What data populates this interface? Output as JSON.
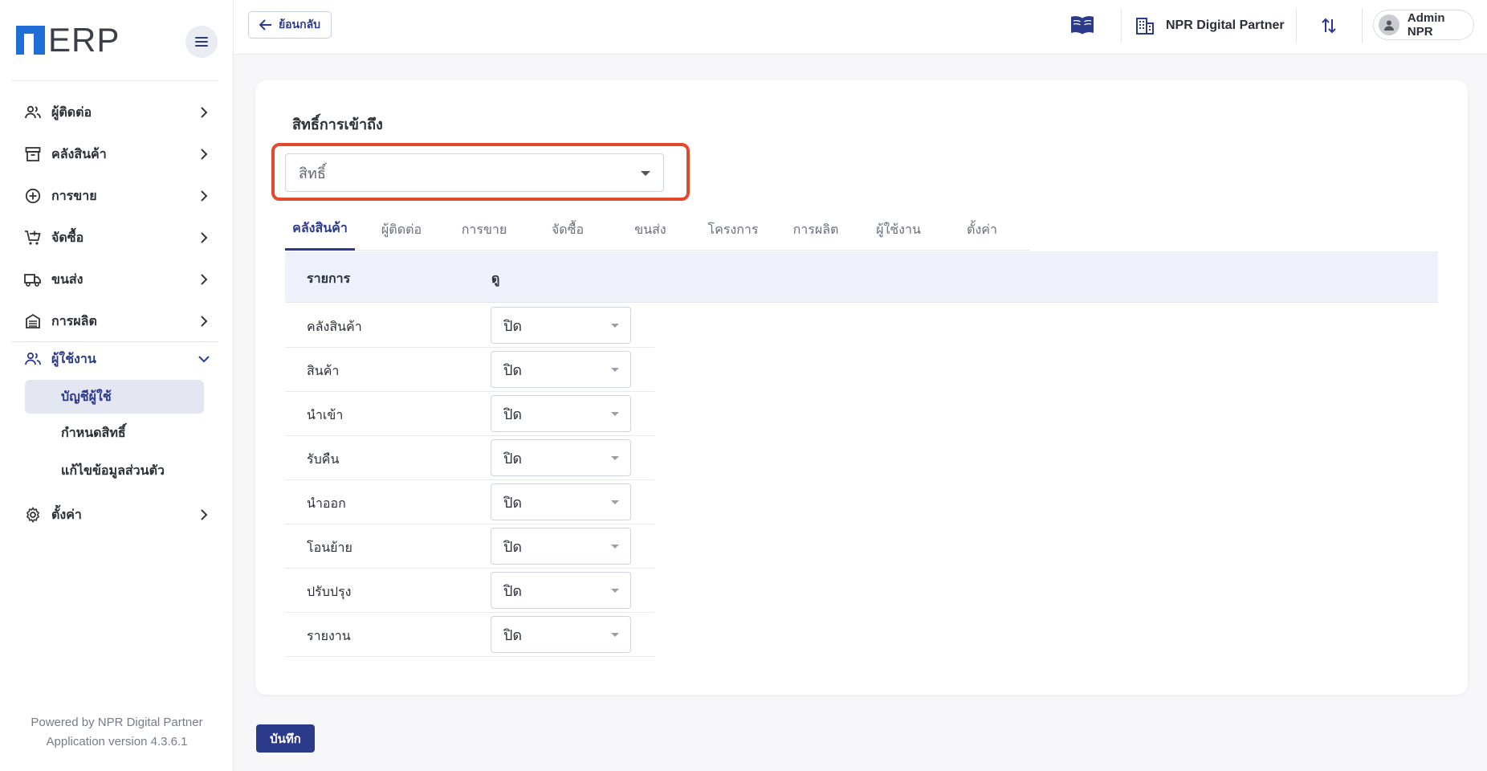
{
  "app": {
    "logo_text": "ERP"
  },
  "sidebar": {
    "items": [
      {
        "label": "ผู้ติดต่อ",
        "icon": "contacts-icon"
      },
      {
        "label": "คลังสินค้า",
        "icon": "archive-box-icon"
      },
      {
        "label": "การขาย",
        "icon": "plus-circle-icon"
      },
      {
        "label": "จัดซื้อ",
        "icon": "cart-plus-icon"
      },
      {
        "label": "ขนส่ง",
        "icon": "truck-icon"
      },
      {
        "label": "การผลิต",
        "icon": "factory-icon"
      },
      {
        "label": "ผู้ใช้งาน",
        "icon": "users-icon",
        "expanded": true
      },
      {
        "label": "ตั้งค่า",
        "icon": "gear-icon"
      }
    ],
    "subitems": [
      {
        "label": "บัญชีผู้ใช้",
        "selected": true
      },
      {
        "label": "กำหนดสิทธิ์",
        "selected": false
      },
      {
        "label": "แก้ไขข้อมูลส่วนตัว",
        "selected": false
      }
    ],
    "powered_by": "Powered by NPR Digital Partner",
    "version": "Application version 4.3.6.1"
  },
  "topbar": {
    "back_label": "ย้อนกลับ",
    "company": "NPR Digital Partner",
    "user": "Admin NPR"
  },
  "main": {
    "section_title": "สิทธิ์การเข้าถึง",
    "role_select": {
      "value": "สิทธิ์"
    },
    "tabs": [
      {
        "label": "คลังสินค้า",
        "active": true
      },
      {
        "label": "ผู้ติดต่อ"
      },
      {
        "label": "การขาย"
      },
      {
        "label": "จัดซื้อ"
      },
      {
        "label": "ขนส่ง"
      },
      {
        "label": "โครงการ"
      },
      {
        "label": "การผลิต"
      },
      {
        "label": "ผู้ใช้งาน"
      },
      {
        "label": "ตั้งค่า"
      }
    ],
    "table": {
      "headers": [
        "รายการ",
        "ดู"
      ],
      "rows": [
        {
          "name": "คลังสินค้า",
          "value": "ปิด"
        },
        {
          "name": "สินค้า",
          "value": "ปิด"
        },
        {
          "name": "นำเข้า",
          "value": "ปิด"
        },
        {
          "name": "รับคืน",
          "value": "ปิด"
        },
        {
          "name": "นำออก",
          "value": "ปิด"
        },
        {
          "name": "โอนย้าย",
          "value": "ปิด"
        },
        {
          "name": "ปรับปรุง",
          "value": "ปิด"
        },
        {
          "name": "รายงาน",
          "value": "ปิด"
        }
      ]
    },
    "save_label": "บันทึก"
  },
  "colors": {
    "accent": "#2c3a8c",
    "brand_blue": "#1f6fd6",
    "highlight": "#e24a2e"
  }
}
